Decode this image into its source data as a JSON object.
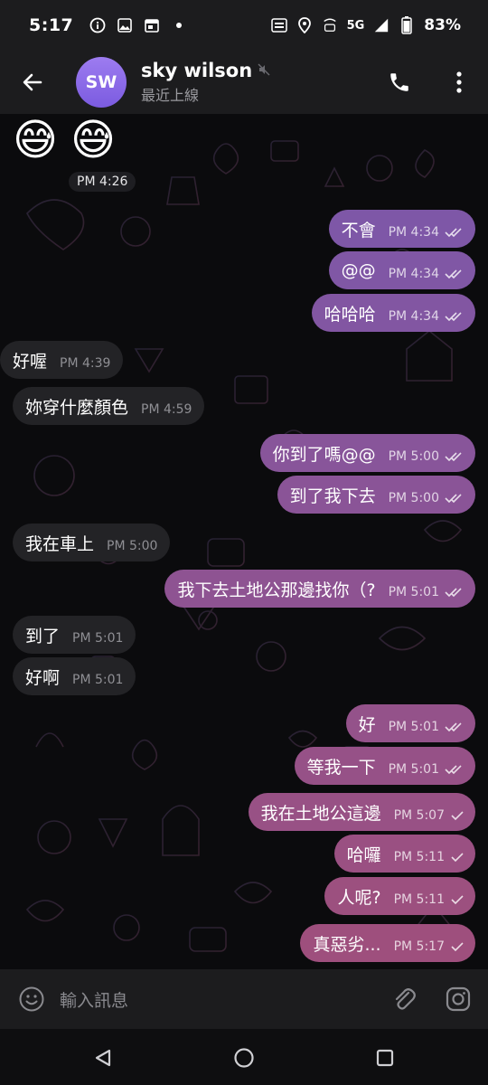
{
  "status_bar": {
    "time": "5:17",
    "battery": "83%",
    "network_label": "5G",
    "icons": [
      "info-icon",
      "image-icon",
      "calendar-icon",
      "dot-icon",
      "auto-icon",
      "location-icon",
      "volte-icon",
      "signal-icon",
      "battery-icon"
    ]
  },
  "header": {
    "avatar_initials": "SW",
    "name": "sky wilson",
    "status": "最近上線",
    "muted": true
  },
  "chat": {
    "emojis": [
      "😅",
      "😅"
    ],
    "first_time": "PM 4:26",
    "messages": [
      {
        "dir": "out",
        "text": "不會",
        "time": "PM 4:34",
        "read": true
      },
      {
        "dir": "out",
        "text": "@@",
        "time": "PM 4:34",
        "read": true
      },
      {
        "dir": "out",
        "text": "哈哈哈",
        "time": "PM 4:34",
        "read": true
      },
      {
        "dir": "in",
        "text": "好喔",
        "time": "PM 4:39"
      },
      {
        "dir": "in",
        "text": "妳穿什麼顏色",
        "time": "PM 4:59"
      },
      {
        "dir": "out",
        "text": "你到了嗎@@",
        "time": "PM 5:00",
        "read": true
      },
      {
        "dir": "out",
        "text": "到了我下去",
        "time": "PM 5:00",
        "read": true
      },
      {
        "dir": "in",
        "text": "我在車上",
        "time": "PM 5:00"
      },
      {
        "dir": "out",
        "text": "我下去土地公那邊找你（?",
        "time": "PM 5:01",
        "read": true
      },
      {
        "dir": "in",
        "text": "到了",
        "time": "PM 5:01"
      },
      {
        "dir": "in",
        "text": "好啊",
        "time": "PM 5:01"
      },
      {
        "dir": "out",
        "text": "好",
        "time": "PM 5:01",
        "read": true
      },
      {
        "dir": "out",
        "text": "等我一下",
        "time": "PM 5:01",
        "read": true
      },
      {
        "dir": "out",
        "text": "我在土地公這邊",
        "time": "PM 5:07",
        "read": false
      },
      {
        "dir": "out",
        "text": "哈囉",
        "time": "PM 5:11",
        "read": false
      },
      {
        "dir": "out",
        "text": "人呢?",
        "time": "PM 5:11",
        "read": false
      },
      {
        "dir": "out",
        "text": "真惡劣...",
        "time": "PM 5:17",
        "read": false
      }
    ]
  },
  "input": {
    "placeholder": "輸入訊息"
  },
  "colors": {
    "bubble_out_top": "#7a58ad",
    "bubble_out_bottom": "#a04f7a",
    "bubble_in": "#232326",
    "avatar": "#8b6ce8"
  }
}
